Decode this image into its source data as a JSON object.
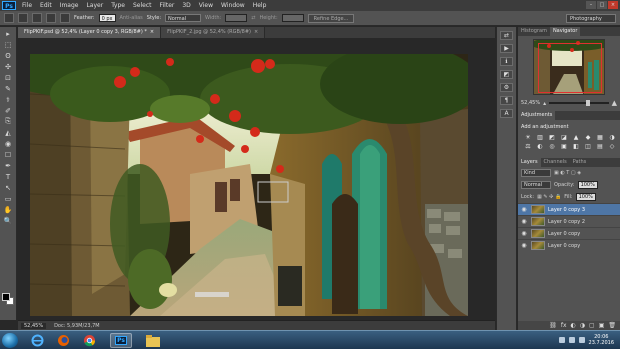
{
  "menu": {
    "logo": "Ps",
    "items": [
      "File",
      "Edit",
      "Image",
      "Layer",
      "Type",
      "Select",
      "Filter",
      "3D",
      "View",
      "Window",
      "Help"
    ]
  },
  "window_controls": {
    "minimize": "–",
    "maximize": "□",
    "close": "×"
  },
  "options": {
    "feather_label": "Feather:",
    "feather_value": "0 px",
    "antialias_label": "Anti-alias",
    "style_label": "Style:",
    "style_value": "Normal",
    "width_label": "Width:",
    "height_label": "Height:",
    "refine_edge": "Refine Edge...",
    "workspace": "Photography"
  },
  "tabs": [
    {
      "label": "FlipPKIF.psd @ 52,4% (Layer 0 copy 3, RGB/8#) *",
      "close": "×"
    },
    {
      "label": "FlipPKIF_2.jpg @ 52,4% (RGB/8#)",
      "close": "×"
    }
  ],
  "status": {
    "zoom": "52,45%",
    "doc": "Doc: 5,93M/23,7M"
  },
  "navigator": {
    "tabs": [
      "Histogram",
      "Navigator"
    ],
    "zoom": "52,45%"
  },
  "adjustments": {
    "tab": "Adjustments",
    "title": "Add an adjustment",
    "icons": [
      "☀",
      "▥",
      "◩",
      "◪",
      "▲",
      "◆",
      "▦",
      "◑",
      "⚖",
      "◐",
      "◎",
      "▣",
      "◧",
      "◫",
      "▤",
      "◇"
    ]
  },
  "layers": {
    "tabs": [
      "Layers",
      "Channels",
      "Paths"
    ],
    "kind": "Kind",
    "blend_mode": "Normal",
    "opacity_label": "Opacity:",
    "opacity_value": "100%",
    "lock_label": "Lock:",
    "fill_label": "Fill:",
    "fill_value": "100%",
    "rows": [
      {
        "name": "Layer 0 copy 3",
        "active": true
      },
      {
        "name": "Layer 0 copy 2",
        "active": false
      },
      {
        "name": "Layer 0 copy",
        "active": false
      },
      {
        "name": "Layer 0 copy",
        "active": false
      }
    ],
    "footer_icons": [
      "⛓",
      "fx",
      "◐",
      "◑",
      "▢",
      "▣",
      "🗑"
    ]
  },
  "toolbar_icons": [
    "▸",
    "⬚",
    "ʘ",
    "✣",
    "⊡",
    "✎",
    "⚕",
    "✐",
    "⎘",
    "◭",
    "◉",
    "☐",
    "✒",
    "T",
    "↖",
    "▭",
    "✋",
    "🔍"
  ],
  "iconcol_icons": [
    "⇄",
    "▶",
    "ℹ",
    "◩",
    "⚙",
    "¶",
    "A"
  ],
  "taskbar": {
    "apps": [
      "ie-icon",
      "firefox-icon",
      "chrome-icon",
      "photoshop-icon",
      "explorer-icon"
    ],
    "time": "20:06",
    "date": "23.7.2016"
  }
}
